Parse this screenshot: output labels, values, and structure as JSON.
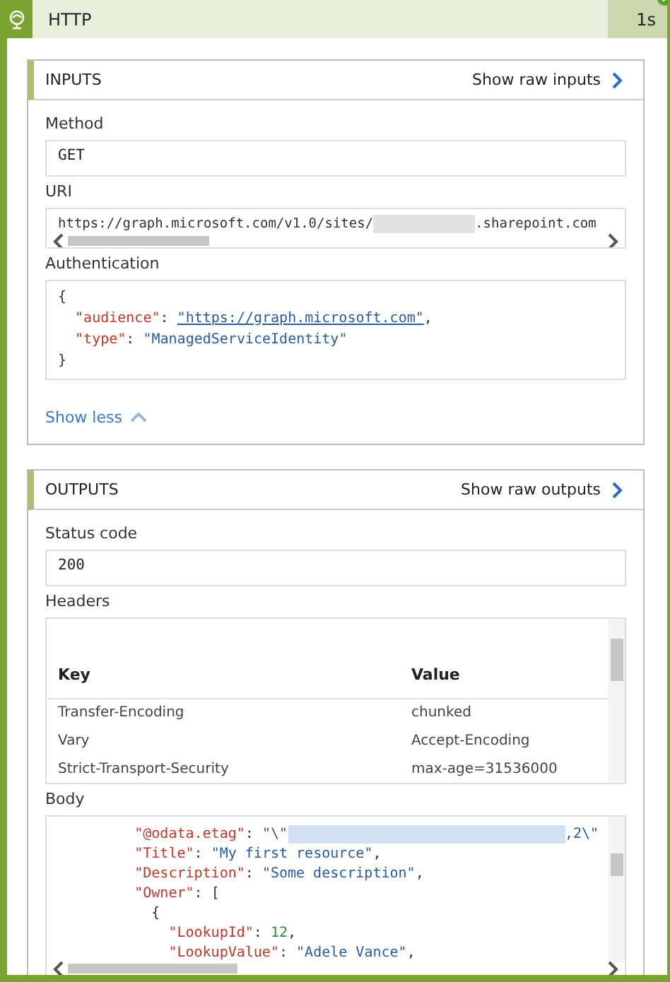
{
  "action": {
    "title": "HTTP",
    "duration": "1s",
    "succeeded": true
  },
  "inputs": {
    "title": "INPUTS",
    "raw_link": "Show raw inputs",
    "fields": [
      {
        "label": "Method",
        "kind": "text",
        "value": "GET"
      },
      {
        "label": "URI",
        "kind": "scroll",
        "parts": [
          {
            "kind": "text",
            "text": "https://graph.microsoft.com/v1.0/sites/"
          },
          {
            "kind": "mask"
          },
          {
            "kind": "text",
            "text": ".sharepoint.com"
          }
        ]
      },
      {
        "label": "Authentication",
        "kind": "code",
        "lines": [
          [
            {
              "kind": "punct",
              "text": "{"
            }
          ],
          [
            {
              "kind": "key",
              "text": "  \"audience\""
            },
            {
              "kind": "punct",
              "text": ": "
            },
            {
              "kind": "link",
              "text": "\"https://graph.microsoft.com\""
            },
            {
              "kind": "punct",
              "text": ","
            }
          ],
          [
            {
              "kind": "key",
              "text": "  \"type\""
            },
            {
              "kind": "punct",
              "text": ": "
            },
            {
              "kind": "string",
              "text": "\"ManagedServiceIdentity\""
            }
          ],
          [
            {
              "kind": "punct",
              "text": "}"
            }
          ]
        ]
      }
    ],
    "toggle": "Show less"
  },
  "outputs": {
    "title": "OUTPUTS",
    "raw_link": "Show raw outputs",
    "status_label": "Status code",
    "status": "200",
    "headers_label": "Headers",
    "headers": {
      "columns": [
        "Key",
        "Value"
      ],
      "rows": [
        [
          "Transfer-Encoding",
          "chunked"
        ],
        [
          "Vary",
          "Accept-Encoding"
        ],
        [
          "Strict-Transport-Security",
          "max-age=31536000"
        ]
      ]
    },
    "body_label": "Body",
    "body_lines": [
      [
        {
          "kind": "key",
          "text": "      \"@odata.etag\""
        },
        {
          "kind": "punct",
          "text": ": "
        },
        {
          "kind": "string",
          "text": "\"\\\""
        },
        {
          "kind": "selection"
        },
        {
          "kind": "string",
          "text": ",2\\\""
        }
      ],
      [
        {
          "kind": "key",
          "text": "      \"Title\""
        },
        {
          "kind": "punct",
          "text": ": "
        },
        {
          "kind": "string",
          "text": "\"My first resource\""
        },
        {
          "kind": "punct",
          "text": ","
        }
      ],
      [
        {
          "kind": "key",
          "text": "      \"Description\""
        },
        {
          "kind": "punct",
          "text": ": "
        },
        {
          "kind": "string",
          "text": "\"Some description\""
        },
        {
          "kind": "punct",
          "text": ","
        }
      ],
      [
        {
          "kind": "key",
          "text": "      \"Owner\""
        },
        {
          "kind": "punct",
          "text": ": ["
        }
      ],
      [
        {
          "kind": "punct",
          "text": "        {"
        }
      ],
      [
        {
          "kind": "key",
          "text": "          \"LookupId\""
        },
        {
          "kind": "punct",
          "text": ": "
        },
        {
          "kind": "number",
          "text": "12"
        },
        {
          "kind": "punct",
          "text": ","
        }
      ],
      [
        {
          "kind": "key",
          "text": "          \"LookupValue\""
        },
        {
          "kind": "punct",
          "text": ": "
        },
        {
          "kind": "string",
          "text": "\"Adele Vance\""
        },
        {
          "kind": "punct",
          "text": ","
        }
      ]
    ]
  }
}
